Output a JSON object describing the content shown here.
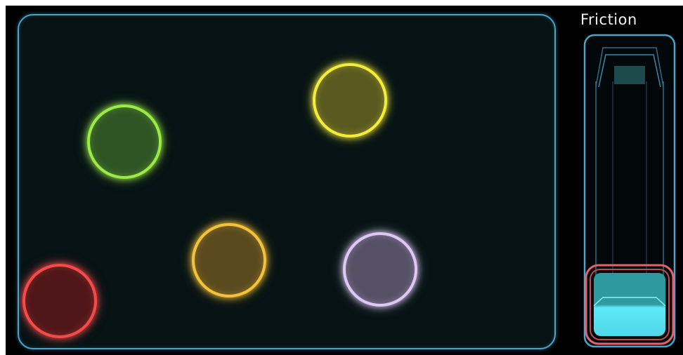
{
  "friction": {
    "label": "Friction",
    "level": 0.0
  },
  "balls": [
    {
      "color": "green",
      "border": "#9bea47",
      "fill": "#2f5524"
    },
    {
      "color": "yellow",
      "border": "#f2ec3c",
      "fill": "#5a5a20"
    },
    {
      "color": "orange",
      "border": "#f4c23a",
      "fill": "#5a4a1e"
    },
    {
      "color": "lavender",
      "border": "#dcc8f2",
      "fill": "#565066"
    },
    {
      "color": "red",
      "border": "#f44a4a",
      "fill": "#4f1719"
    }
  ],
  "colors": {
    "arena_border": "#4aa3c8",
    "arena_background": "#071315",
    "slider_handle_border": "#e8606e",
    "slider_handle_fill": "#2e9aa0",
    "slider_handle_light": "#5fe9f5"
  }
}
